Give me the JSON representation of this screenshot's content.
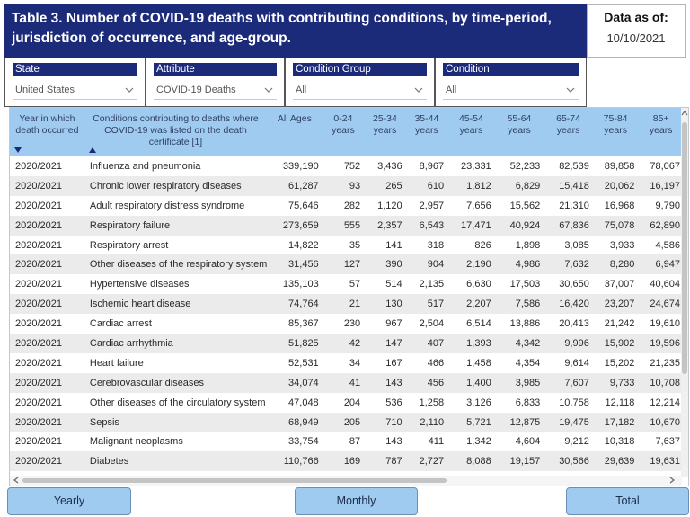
{
  "header": {
    "title": "Table 3. Number of COVID-19 deaths with contributing conditions, by time-period, jurisdiction of occurrence, and age-group.",
    "date_label": "Data as of:",
    "date_value": "10/10/2021"
  },
  "filters": [
    {
      "label": "State",
      "value": "United States"
    },
    {
      "label": "Attribute",
      "value": "COVID-19 Deaths"
    },
    {
      "label": "Condition Group",
      "value": "All"
    },
    {
      "label": "Condition",
      "value": "All"
    }
  ],
  "table": {
    "columns": [
      "Year in which death occurred",
      "Conditions contributing to deaths where COVID-19 was listed on the death certificate [1]",
      "All Ages",
      "0-24 years",
      "25-34 years",
      "35-44 years",
      "45-54 years",
      "55-64 years",
      "65-74 years",
      "75-84 years",
      "85+ years"
    ],
    "rows": [
      [
        "2020/2021",
        "Influenza and pneumonia",
        "339,190",
        "752",
        "3,436",
        "8,967",
        "23,331",
        "52,233",
        "82,539",
        "89,858",
        "78,067"
      ],
      [
        "2020/2021",
        "Chronic lower respiratory diseases",
        "61,287",
        "93",
        "265",
        "610",
        "1,812",
        "6,829",
        "15,418",
        "20,062",
        "16,197"
      ],
      [
        "2020/2021",
        "Adult respiratory distress syndrome",
        "75,646",
        "282",
        "1,120",
        "2,957",
        "7,656",
        "15,562",
        "21,310",
        "16,968",
        "9,790"
      ],
      [
        "2020/2021",
        "Respiratory failure",
        "273,659",
        "555",
        "2,357",
        "6,543",
        "17,471",
        "40,924",
        "67,836",
        "75,078",
        "62,890"
      ],
      [
        "2020/2021",
        "Respiratory arrest",
        "14,822",
        "35",
        "141",
        "318",
        "826",
        "1,898",
        "3,085",
        "3,933",
        "4,586"
      ],
      [
        "2020/2021",
        "Other diseases of the respiratory system",
        "31,456",
        "127",
        "390",
        "904",
        "2,190",
        "4,986",
        "7,632",
        "8,280",
        "6,947"
      ],
      [
        "2020/2021",
        "Hypertensive diseases",
        "135,103",
        "57",
        "514",
        "2,135",
        "6,630",
        "17,503",
        "30,650",
        "37,007",
        "40,604"
      ],
      [
        "2020/2021",
        "Ischemic heart disease",
        "74,764",
        "21",
        "130",
        "517",
        "2,207",
        "7,586",
        "16,420",
        "23,207",
        "24,674"
      ],
      [
        "2020/2021",
        "Cardiac arrest",
        "85,367",
        "230",
        "967",
        "2,504",
        "6,514",
        "13,886",
        "20,413",
        "21,242",
        "19,610"
      ],
      [
        "2020/2021",
        "Cardiac arrhythmia",
        "51,825",
        "42",
        "147",
        "407",
        "1,393",
        "4,342",
        "9,996",
        "15,902",
        "19,596"
      ],
      [
        "2020/2021",
        "Heart failure",
        "52,531",
        "34",
        "167",
        "466",
        "1,458",
        "4,354",
        "9,614",
        "15,202",
        "21,235"
      ],
      [
        "2020/2021",
        "Cerebrovascular diseases",
        "34,074",
        "41",
        "143",
        "456",
        "1,400",
        "3,985",
        "7,607",
        "9,733",
        "10,708"
      ],
      [
        "2020/2021",
        "Other diseases of the circulatory system",
        "47,048",
        "204",
        "536",
        "1,258",
        "3,126",
        "6,833",
        "10,758",
        "12,118",
        "12,214"
      ],
      [
        "2020/2021",
        "Sepsis",
        "68,949",
        "205",
        "710",
        "2,110",
        "5,721",
        "12,875",
        "19,475",
        "17,182",
        "10,670"
      ],
      [
        "2020/2021",
        "Malignant neoplasms",
        "33,754",
        "87",
        "143",
        "411",
        "1,342",
        "4,604",
        "9,212",
        "10,318",
        "7,637"
      ],
      [
        "2020/2021",
        "Diabetes",
        "110,766",
        "169",
        "787",
        "2,727",
        "8,088",
        "19,157",
        "30,566",
        "29,639",
        "19,631"
      ]
    ]
  },
  "buttons": {
    "yearly": "Yearly",
    "monthly": "Monthly",
    "total": "Total"
  },
  "colors": {
    "header_bg": "#1c2a7a",
    "table_header_bg": "#9fcbf0",
    "button_bg": "#9fcbf0",
    "stripe": "#ebebeb"
  },
  "icons": {
    "dropdown": "chevron-down-icon",
    "sort_desc": "sort-descending-icon",
    "sort_asc": "sort-ascending-icon"
  }
}
